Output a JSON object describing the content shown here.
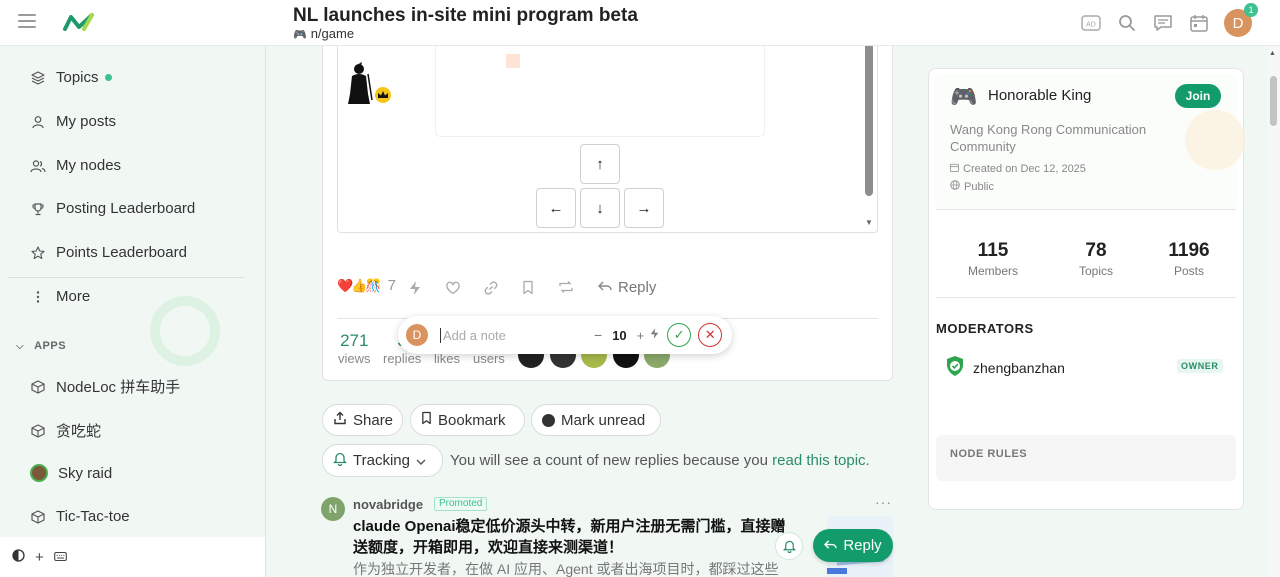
{
  "header": {
    "title": "NL launches in-site mini program beta",
    "category": "n/game",
    "avatar_letter": "D",
    "notification_count": "1"
  },
  "sidebar": {
    "items": [
      {
        "label": "Topics",
        "icon": "layers-icon"
      },
      {
        "label": "My posts",
        "icon": "user-icon"
      },
      {
        "label": "My nodes",
        "icon": "users-icon"
      },
      {
        "label": "Posting Leaderboard",
        "icon": "trophy-icon"
      },
      {
        "label": "Points Leaderboard",
        "icon": "star-icon"
      },
      {
        "label": "More",
        "icon": "ellipsis-vertical-icon"
      }
    ],
    "apps_header": "APPS",
    "apps": [
      {
        "label": "NodeLoc 拼车助手",
        "icon": "cube-icon"
      },
      {
        "label": "贪吃蛇",
        "icon": "cube-icon"
      },
      {
        "label": "Sky raid",
        "icon": "app-thumbnail"
      },
      {
        "label": "Tic-Tac-toe",
        "icon": "cube-icon"
      }
    ]
  },
  "game": {
    "up": "↑",
    "left": "←",
    "down": "↓",
    "right": "→"
  },
  "post": {
    "reaction_emojis": "❤️👍🎊",
    "reaction_count": "7",
    "reply_label": "Reply",
    "stats": {
      "views": {
        "value": "271",
        "label": "views"
      },
      "replies": {
        "value": "3",
        "label": "replies"
      },
      "likes": {
        "label": "likes"
      },
      "users": {
        "label": "users"
      }
    }
  },
  "note_popup": {
    "avatar_letter": "D",
    "placeholder": "Add a note",
    "value": "10",
    "minus": "−",
    "plus": "+"
  },
  "actions": {
    "share": "Share",
    "bookmark": "Bookmark",
    "mark_unread": "Mark unread",
    "tracking": "Tracking",
    "tracking_text": "You will see a count of new replies because you ",
    "tracking_link": "read this topic."
  },
  "promo": {
    "avatar_letter": "N",
    "user": "novabridge",
    "tag": "Promoted",
    "title": "claude Openai稳定低价源头中转，新用户注册无需门槛，直接赠送额度，开箱即用，欢迎直接来测渠道！",
    "desc": "作为独立开发者，在做 AI 应用、Agent 或者出海项目时，都踩过这些",
    "reply_fab": "Reply"
  },
  "node": {
    "name": "Honorable King",
    "join": "Join",
    "description": "Wang Kong Rong Communication Community",
    "created": "Created on Dec 12, 2025",
    "visibility": "Public",
    "stats": [
      {
        "value": "115",
        "label": "Members"
      },
      {
        "value": "78",
        "label": "Topics"
      },
      {
        "value": "1196",
        "label": "Posts"
      }
    ],
    "moderators_header": "MODERATORS",
    "moderator": "zhengbanzhan",
    "moderator_role": "OWNER",
    "rules_header": "NODE RULES"
  },
  "colors": {
    "accent": "#139c6b",
    "sidebar_bg": "#f1f8f4",
    "link": "#2a8c6a"
  }
}
